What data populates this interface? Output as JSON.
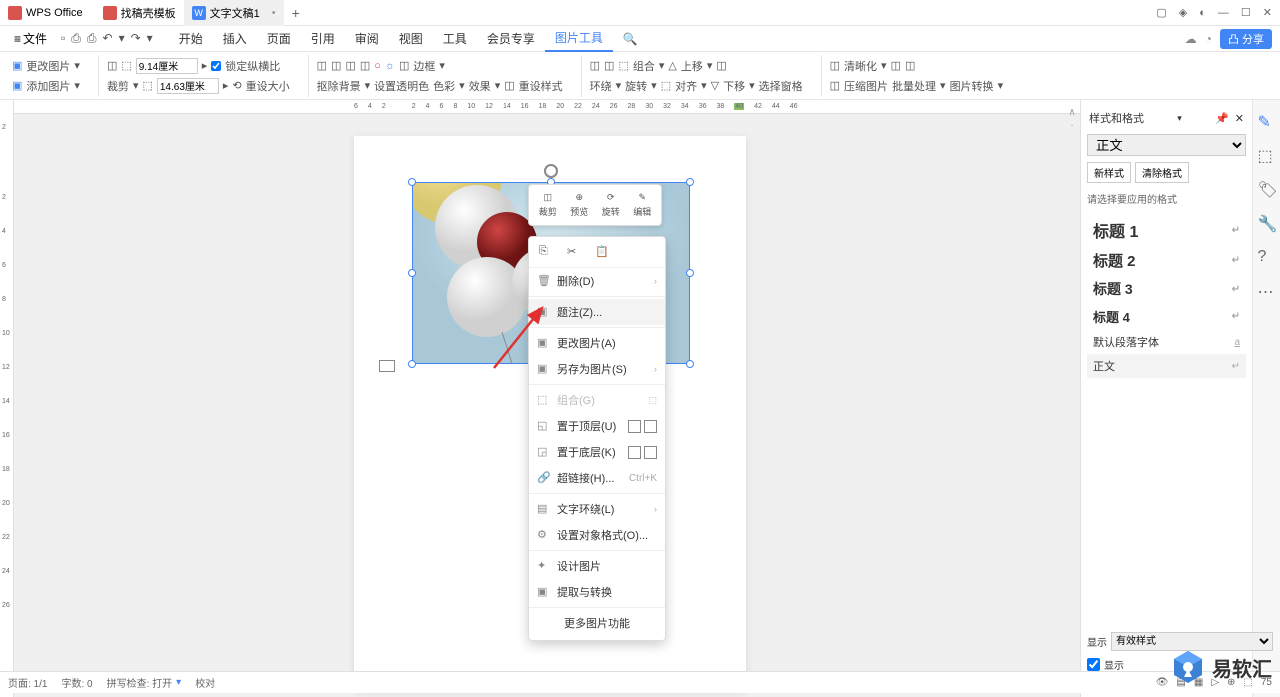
{
  "titlebar": {
    "app_name": "WPS Office",
    "tabs": [
      {
        "label": "找稿壳模板",
        "icon": "red"
      },
      {
        "label": "文字文稿1",
        "icon": "blue",
        "letter": "W"
      }
    ]
  },
  "menubar": {
    "file": "文件",
    "items": [
      "开始",
      "插入",
      "页面",
      "引用",
      "审阅",
      "视图",
      "工具",
      "会员专享",
      "图片工具"
    ],
    "share": "分享"
  },
  "ribbon": {
    "change_pic": "更改图片",
    "add_pic": "添加图片",
    "crop": "裁剪",
    "width_val": "9.14厘米",
    "height_val": "14.63厘米",
    "lock_ratio": "锁定纵横比",
    "reset_size": "重设大小",
    "remove_bg": "抠除背景",
    "set_transparent": "设置透明色",
    "color": "色彩",
    "effect": "效果",
    "border": "边框",
    "reset_style": "重设样式",
    "wrap": "环绕",
    "rotate": "旋转",
    "group": "组合",
    "align": "对齐",
    "up": "上移",
    "down": "下移",
    "select_pane": "选择窗格",
    "clarify": "清晰化",
    "compress": "压缩图片",
    "batch": "批量处理",
    "convert": "图片转换"
  },
  "ruler": {
    "h": [
      "6",
      "4",
      "2",
      "",
      "2",
      "4",
      "6",
      "8",
      "10",
      "12",
      "14",
      "16",
      "18",
      "20",
      "22",
      "24",
      "26",
      "28",
      "30",
      "32",
      "34",
      "36",
      "38",
      "40",
      "42",
      "44",
      "46"
    ],
    "v": [
      "2",
      "",
      "2",
      "4",
      "6",
      "8",
      "10",
      "12",
      "14",
      "16",
      "18",
      "20",
      "22",
      "24",
      "26"
    ]
  },
  "float_toolbar": {
    "crop": "裁剪",
    "preview": "预览",
    "rotate": "旋转",
    "edit": "编辑"
  },
  "context_menu": {
    "delete": "删除(D)",
    "caption": "题注(Z)...",
    "change_pic": "更改图片(A)",
    "save_as": "另存为图片(S)",
    "group": "组合(G)",
    "bring_front": "置于顶层(U)",
    "send_back": "置于底层(K)",
    "hyperlink": "超链接(H)...",
    "hyperlink_sc": "Ctrl+K",
    "text_wrap": "文字环绕(L)",
    "format_obj": "设置对象格式(O)...",
    "design": "设计图片",
    "extract": "提取与转换",
    "more": "更多图片功能"
  },
  "right_panel": {
    "title": "样式和格式",
    "current": "正文",
    "new_style": "新样式",
    "clear_format": "清除格式",
    "hint": "请选择要应用的格式",
    "styles": [
      {
        "label": "标题 1",
        "cls": "h1"
      },
      {
        "label": "标题 2",
        "cls": "h2"
      },
      {
        "label": "标题 3",
        "cls": "h3"
      },
      {
        "label": "标题 4",
        "cls": "h4"
      },
      {
        "label": "默认段落字体",
        "cls": "def"
      },
      {
        "label": "正文",
        "cls": "body selected"
      }
    ],
    "show_label": "显示",
    "show_value": "有效样式",
    "show_preview": "显示"
  },
  "statusbar": {
    "page": "页面: 1/1",
    "words": "字数: 0",
    "spell": "拼写检查: 打开",
    "proof": "校对",
    "zoom": "75"
  },
  "watermark": "易软汇"
}
